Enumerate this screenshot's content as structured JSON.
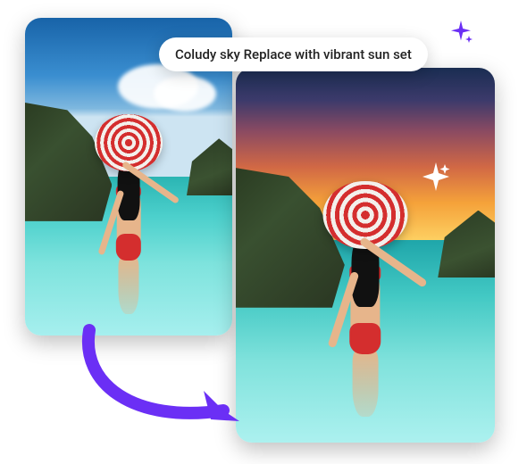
{
  "prompt": {
    "text": "Coludy sky Replace with vibrant sun set"
  },
  "colors": {
    "accent": "#6b2ff5",
    "sparkle": "#ffffff"
  }
}
